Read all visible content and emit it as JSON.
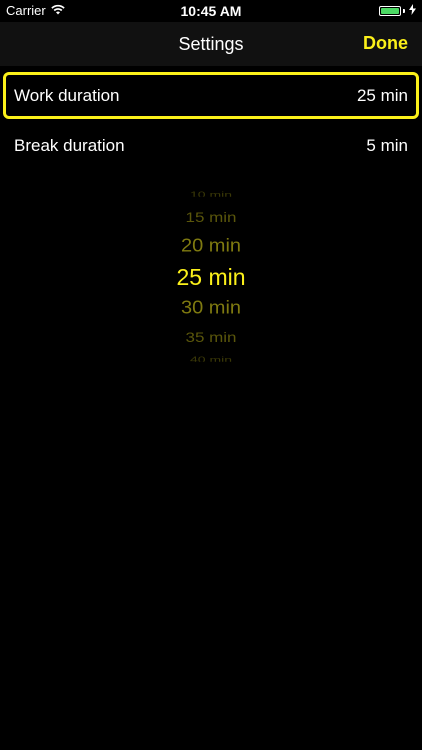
{
  "status_bar": {
    "carrier": "Carrier",
    "time": "10:45 AM",
    "wifi_icon": "wifi-icon",
    "battery_icon": "battery-icon",
    "charging_icon": "charging-bolt-icon",
    "battery_level": 1.0,
    "battery_color": "#4cd964"
  },
  "nav_bar": {
    "title": "Settings",
    "done_label": "Done",
    "accent_color": "#fbf01a"
  },
  "settings": {
    "rows": [
      {
        "label": "Work duration",
        "value": "25 min",
        "selected": true
      },
      {
        "label": "Break duration",
        "value": "5 min",
        "selected": false
      }
    ]
  },
  "picker": {
    "options": [
      "10 min",
      "15 min",
      "20 min",
      "25 min",
      "30 min",
      "35 min",
      "40 min"
    ],
    "selected": "25 min",
    "selected_color": "#fbf01a"
  }
}
